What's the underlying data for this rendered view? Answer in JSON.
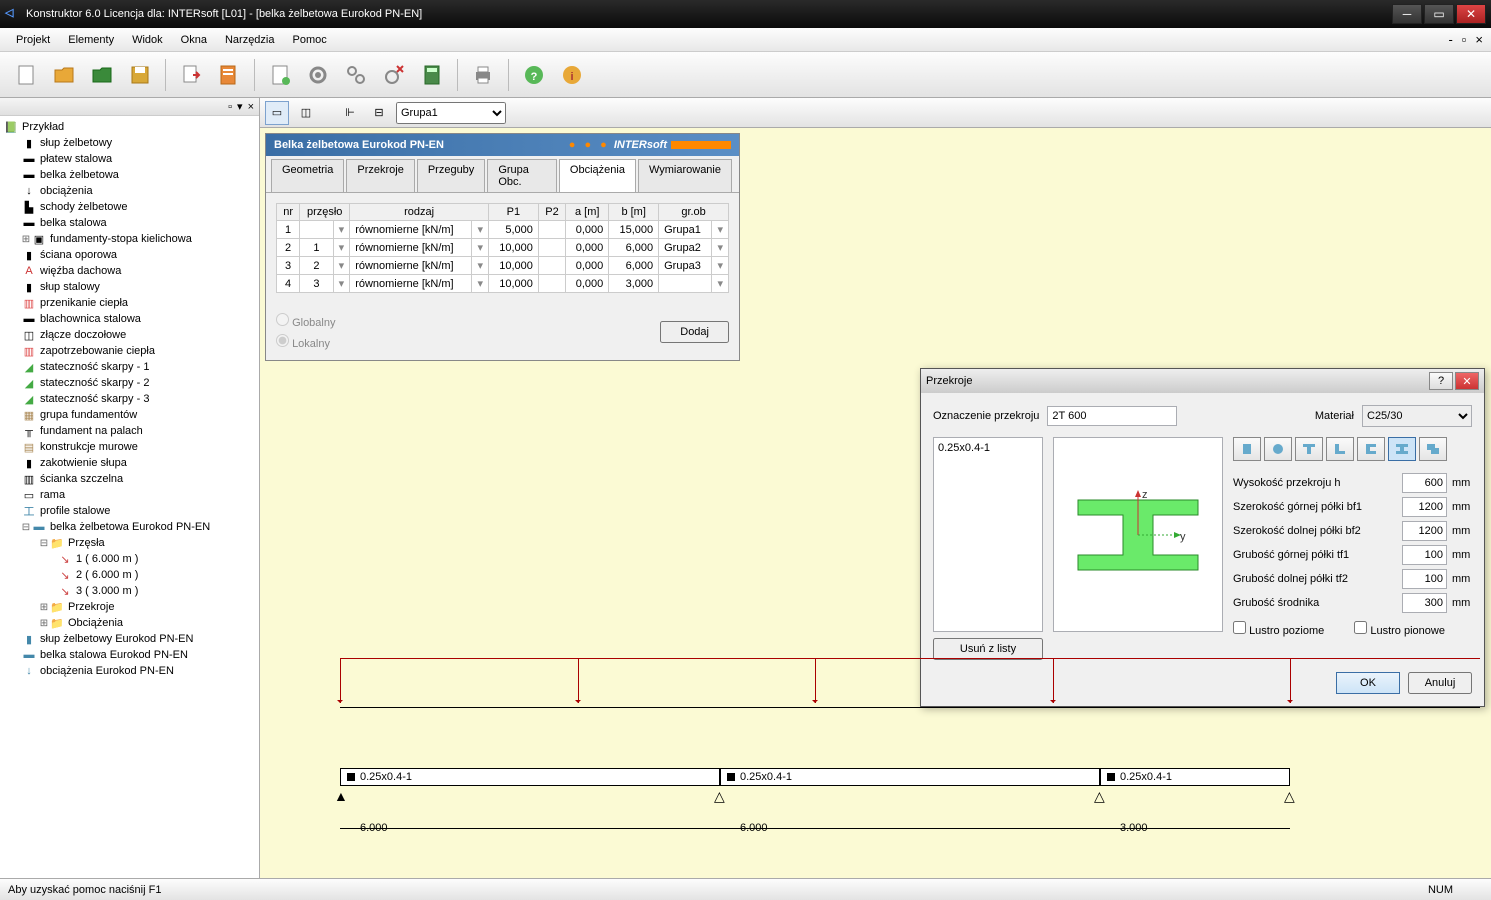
{
  "app": {
    "title": "Konstruktor 6.0 Licencja dla: INTERsoft [L01] - [belka żelbetowa Eurokod PN-EN]"
  },
  "menu": {
    "items": [
      "Projekt",
      "Elementy",
      "Widok",
      "Okna",
      "Narzędzia",
      "Pomoc"
    ]
  },
  "secondaryToolbar": {
    "groupSelect": "Grupa1"
  },
  "tree": {
    "root": "Przykład",
    "items": [
      "słup żelbetowy",
      "płatew stalowa",
      "belka żelbetowa",
      "obciążenia",
      "schody żelbetowe",
      "belka stalowa",
      "fundamenty-stopa kielichowa",
      "ściana oporowa",
      "więźba dachowa",
      "słup stalowy",
      "przenikanie ciepła",
      "blachownica stalowa",
      "złącze doczołowe",
      "zapotrzebowanie ciepła",
      "stateczność skarpy - 1",
      "stateczność skarpy - 2",
      "stateczność skarpy - 3",
      "grupa fundamentów",
      "fundament na palach",
      "konstrukcje murowe",
      "zakotwienie słupa",
      "ścianka szczelna",
      "rama",
      "profile stalowe",
      "belka żelbetowa Eurokod PN-EN"
    ],
    "spans": {
      "label": "Przęsła",
      "items": [
        "1 ( 6.000 m )",
        "2 ( 6.000 m )",
        "3 ( 3.000 m )"
      ]
    },
    "sub": [
      "Przekroje",
      "Obciążenia"
    ],
    "extra": [
      "słup żelbetowy Eurokod PN-EN",
      "belka stalowa Eurokod PN-EN",
      "obciążenia Eurokod PN-EN"
    ]
  },
  "panel": {
    "title": "Belka żelbetowa Eurokod PN-EN",
    "brand": "INTERsoft",
    "tabs": [
      "Geometria",
      "Przekroje",
      "Przeguby",
      "Grupa Obc.",
      "Obciążenia",
      "Wymiarowanie"
    ],
    "activeTab": "Obciążenia",
    "table": {
      "headers": [
        "nr",
        "przęsło",
        "rodzaj",
        "P1",
        "P2",
        "a [m]",
        "b [m]",
        "gr.ob"
      ],
      "rows": [
        {
          "nr": "1",
          "span": "",
          "rodzaj": "równomierne [kN/m]",
          "p1": "5,000",
          "p2": "",
          "a": "0,000",
          "b": "15,000",
          "gr": "Grupa1"
        },
        {
          "nr": "2",
          "span": "1",
          "rodzaj": "równomierne [kN/m]",
          "p1": "10,000",
          "p2": "",
          "a": "0,000",
          "b": "6,000",
          "gr": "Grupa2"
        },
        {
          "nr": "3",
          "span": "2",
          "rodzaj": "równomierne [kN/m]",
          "p1": "10,000",
          "p2": "",
          "a": "0,000",
          "b": "6,000",
          "gr": "Grupa3"
        },
        {
          "nr": "4",
          "span": "3",
          "rodzaj": "równomierne [kN/m]",
          "p1": "10,000",
          "p2": "",
          "a": "0,000",
          "b": "3,000",
          "gr": ""
        }
      ]
    },
    "globalny": "Globalny",
    "lokalny": "Lokalny",
    "addBtn": "Dodaj"
  },
  "dialog": {
    "title": "Przekroje",
    "oznaczenie_label": "Oznaczenie przekroju",
    "oznaczenie": "2T 600",
    "material_label": "Materiał",
    "material": "C25/30",
    "listItem": "0.25x0.4-1",
    "removeBtn": "Usuń z listy",
    "props": [
      {
        "label": "Wysokość przekroju h",
        "value": "600",
        "unit": "mm"
      },
      {
        "label": "Szerokość górnej półki bf1",
        "value": "1200",
        "unit": "mm"
      },
      {
        "label": "Szerokość dolnej półki bf2",
        "value": "1200",
        "unit": "mm"
      },
      {
        "label": "Grubość górnej półki tf1",
        "value": "100",
        "unit": "mm"
      },
      {
        "label": "Grubość dolnej półki tf2",
        "value": "100",
        "unit": "mm"
      },
      {
        "label": "Grubość środnika",
        "value": "300",
        "unit": "mm"
      }
    ],
    "lustroPoziome": "Lustro poziome",
    "lustroPionowe": "Lustro pionowe",
    "ok": "OK",
    "cancel": "Anuluj"
  },
  "beam": {
    "sectionLabel": "0.25x0.4-1",
    "spans": [
      "6.000",
      "6.000",
      "3.000"
    ]
  },
  "statusbar": {
    "help": "Aby uzyskać pomoc naciśnij F1",
    "num": "NUM"
  }
}
